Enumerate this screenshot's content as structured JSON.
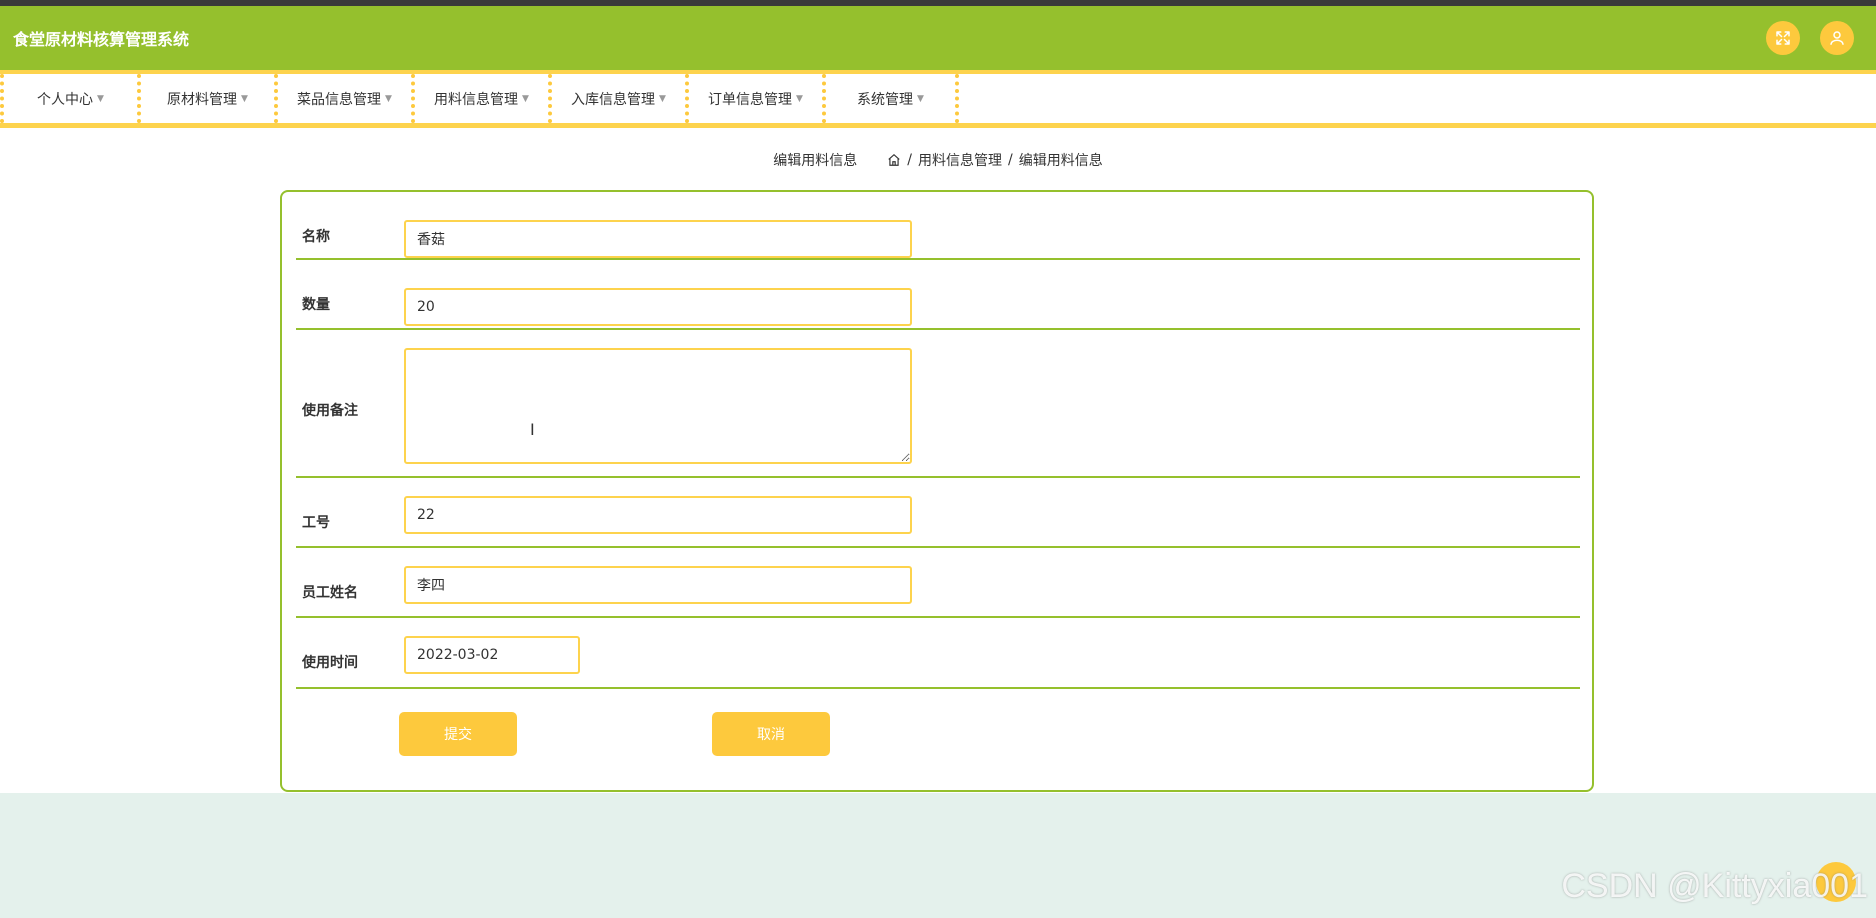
{
  "app": {
    "title": "食堂原材料核算管理系统"
  },
  "header": {
    "fullscreen_icon": "expand-icon",
    "user_icon": "user-icon"
  },
  "menu": {
    "items": [
      {
        "label": "个人中心"
      },
      {
        "label": "原材料管理"
      },
      {
        "label": "菜品信息管理"
      },
      {
        "label": "用料信息管理"
      },
      {
        "label": "入库信息管理"
      },
      {
        "label": "订单信息管理"
      },
      {
        "label": "系统管理"
      }
    ]
  },
  "breadcrumb": {
    "page_title": "编辑用料信息",
    "home_icon": "home-icon",
    "items": [
      "用料信息管理",
      "编辑用料信息"
    ],
    "separator": "/"
  },
  "form": {
    "name": {
      "label": "名称",
      "value": "香菇"
    },
    "quantity": {
      "label": "数量",
      "value": "20"
    },
    "remark": {
      "label": "使用备注",
      "value": ""
    },
    "employee_id": {
      "label": "工号",
      "value": "22"
    },
    "employee_name": {
      "label": "员工姓名",
      "value": "李四"
    },
    "use_time": {
      "label": "使用时间",
      "value": "2022-03-02"
    },
    "submit_label": "提交",
    "cancel_label": "取消"
  },
  "watermark": "CSDN @Kittyxia001",
  "colors": {
    "header_bg": "#95c02d",
    "accent_yellow": "#fdc93d",
    "page_bg": "#e4f1ec"
  }
}
